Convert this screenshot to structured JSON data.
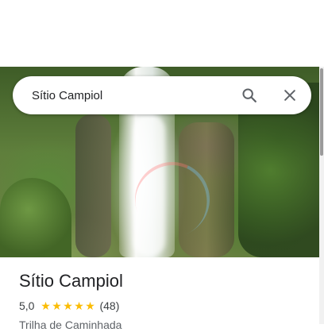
{
  "search": {
    "value": "Sítio Campiol",
    "search_icon": "search-icon",
    "close_icon": "close-icon"
  },
  "place": {
    "name": "Sítio Campiol",
    "rating": "5,0",
    "stars": 5,
    "review_count": "(48)",
    "category": "Trilha de Caminhada",
    "photo_subject": "waterfall"
  },
  "colors": {
    "star": "#fbbc04",
    "title": "#202124",
    "secondary_text": "#5f6368"
  }
}
